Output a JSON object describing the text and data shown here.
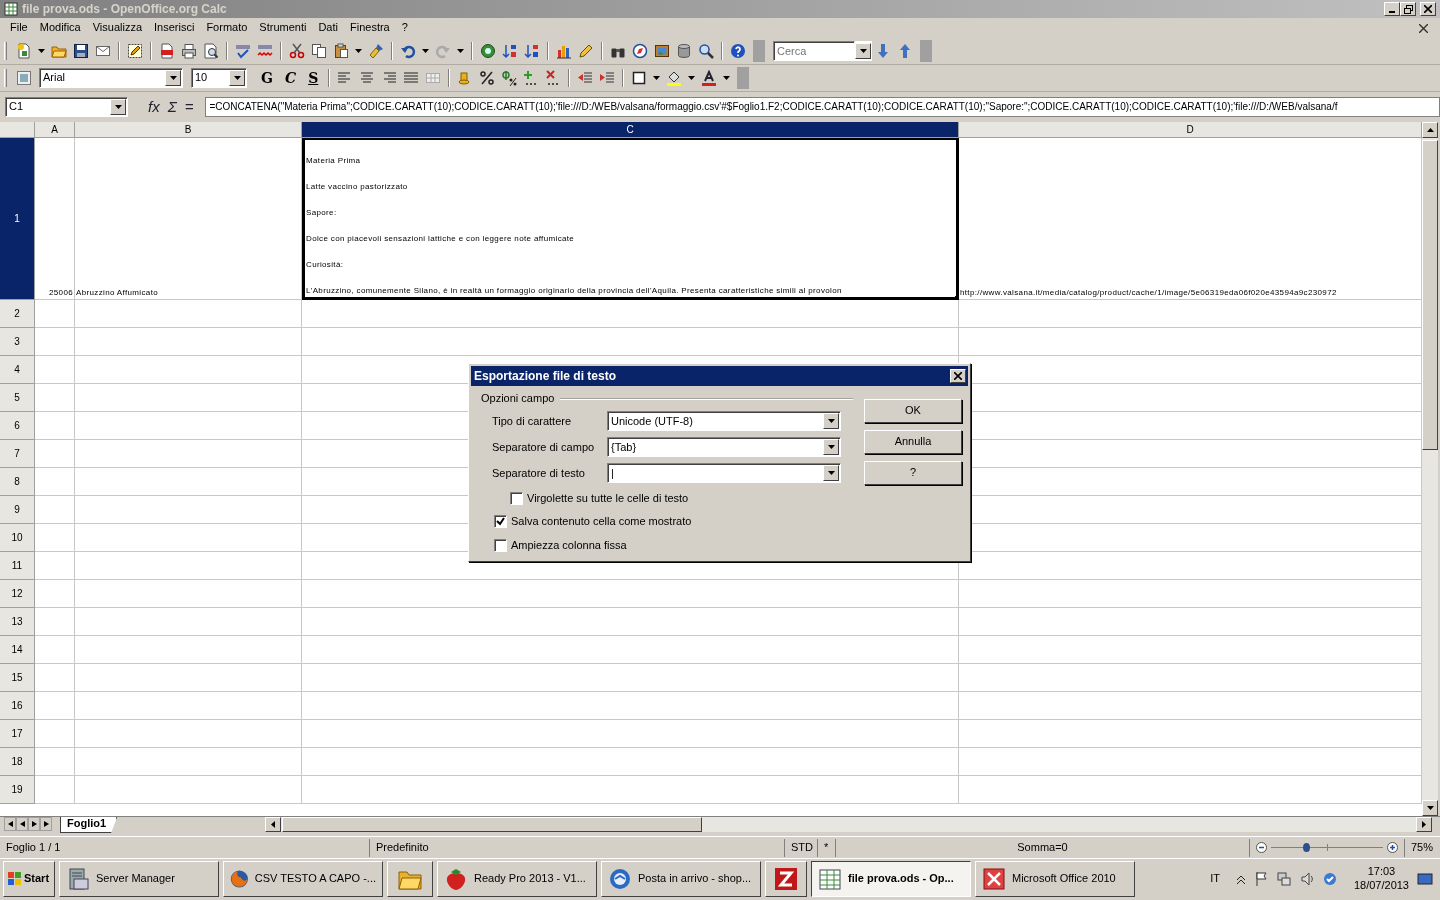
{
  "window": {
    "title": "file prova.ods - OpenOffice.org Calc"
  },
  "menu": [
    "File",
    "Modifica",
    "Visualizza",
    "Inserisci",
    "Formato",
    "Strumenti",
    "Dati",
    "Finestra",
    "?"
  ],
  "toolbar": {
    "search": {
      "placeholder": "Cerca"
    },
    "font_name": "Arial",
    "font_size": "10",
    "text_style_buttons": [
      "G",
      "C",
      "S"
    ]
  },
  "formula_bar": {
    "cell_ref": "C1",
    "tools": [
      "fx",
      "Σ",
      "="
    ],
    "formula": "=CONCATENA(\"Materia Prima\";CODICE.CARATT(10);CODICE.CARATT(10);'file:///D:/WEB/valsana/formaggio.csv'#$Foglio1.F2;CODICE.CARATT(10);CODICE.CARATT(10);\"Sapore:\";CODICE.CARATT(10);CODICE.CARATT(10);'file:///D:/WEB/valsana/f"
  },
  "sheet": {
    "columns": [
      {
        "label": "A",
        "selected": false
      },
      {
        "label": "B",
        "selected": false
      },
      {
        "label": "C",
        "selected": true
      },
      {
        "label": "D",
        "selected": false
      }
    ],
    "rows": [
      {
        "label": "1",
        "selected": true,
        "cells": [
          {
            "kind": "number",
            "selected": false,
            "lines": [
              "25006"
            ]
          },
          {
            "kind": "text",
            "selected": false,
            "lines": [
              "Abruzzino Affumicato"
            ]
          },
          {
            "kind": "text",
            "selected": true,
            "lines": [
              "Materia Prima",
              "Latte vaccino pastorizzato",
              "Sapore:",
              "Dolce con piacevoli sensazioni lattiche e con leggere note affumicate",
              "Curiosità:",
              "L'Abruzzino, comunemente Silano, è in realtà un formaggio originario della provincia dell'Aquila. Presenta caratteristiche simili al provolon"
            ]
          },
          {
            "kind": "text",
            "selected": false,
            "lines": [
              "http://www.valsana.it/media/catalog/product/cache/1/image/5e06319eda06f020e43594a9c230972"
            ]
          }
        ]
      },
      {
        "label": "2",
        "selected": false
      },
      {
        "label": "3",
        "selected": false
      },
      {
        "label": "4",
        "selected": false
      },
      {
        "label": "5",
        "selected": false
      },
      {
        "label": "6",
        "selected": false
      },
      {
        "label": "7",
        "selected": false
      },
      {
        "label": "8",
        "selected": false
      },
      {
        "label": "9",
        "selected": false
      },
      {
        "label": "10",
        "selected": false
      },
      {
        "label": "11",
        "selected": false
      },
      {
        "label": "12",
        "selected": false
      },
      {
        "label": "13",
        "selected": false
      },
      {
        "label": "14",
        "selected": false
      },
      {
        "label": "15",
        "selected": false
      },
      {
        "label": "16",
        "selected": false
      },
      {
        "label": "17",
        "selected": false
      },
      {
        "label": "18",
        "selected": false
      },
      {
        "label": "19",
        "selected": false
      }
    ],
    "tabs": [
      {
        "label": "Foglio1",
        "selected": true
      }
    ]
  },
  "dialog": {
    "title": "Esportazione file di testo",
    "group": "Opzioni campo",
    "fields": [
      {
        "label": "Tipo di carattere",
        "value": "Unicode (UTF-8)"
      },
      {
        "label": "Separatore di campo",
        "value": "{Tab}"
      },
      {
        "label": "Separatore di testo",
        "value": "|"
      }
    ],
    "options": [
      {
        "label": "Virgolette su tutte le celle di testo",
        "checked": false,
        "kind": "sub-option"
      },
      {
        "label": "Salva contenuto cella come mostrato",
        "checked": true,
        "kind": "option"
      },
      {
        "label": "Ampiezza colonna fissa",
        "checked": false,
        "kind": "option"
      }
    ],
    "buttons": [
      "OK",
      "Annulla",
      "?"
    ]
  },
  "status_bar": {
    "sheet": "Foglio 1 / 1",
    "page_style": "Predefinito",
    "mode": "STD",
    "modified": "*",
    "sum": "Somma=0",
    "zoom": {
      "level": 0.31,
      "reading": "75%"
    }
  },
  "taskbar": {
    "start": "Start",
    "tasks": [
      {
        "kind": "server",
        "label": "Server Manager",
        "selected": false
      },
      {
        "kind": "browser",
        "label": "CSV TESTO A CAPO -...",
        "selected": false
      },
      {
        "kind": "folder",
        "selected": false
      },
      {
        "kind": "strawberry",
        "label": "Ready Pro 2013 - V1...",
        "selected": false
      },
      {
        "kind": "mail",
        "label": "Posta in arrivo - shop...",
        "selected": false
      },
      {
        "kind": "ftp",
        "selected": false
      },
      {
        "kind": "calc",
        "label": "file prova.ods - Op...",
        "selected": true
      },
      {
        "kind": "office",
        "label": "Microsoft Office 2010",
        "selected": false
      }
    ],
    "language": "IT",
    "time": "17:03",
    "date": "18/07/2013"
  }
}
